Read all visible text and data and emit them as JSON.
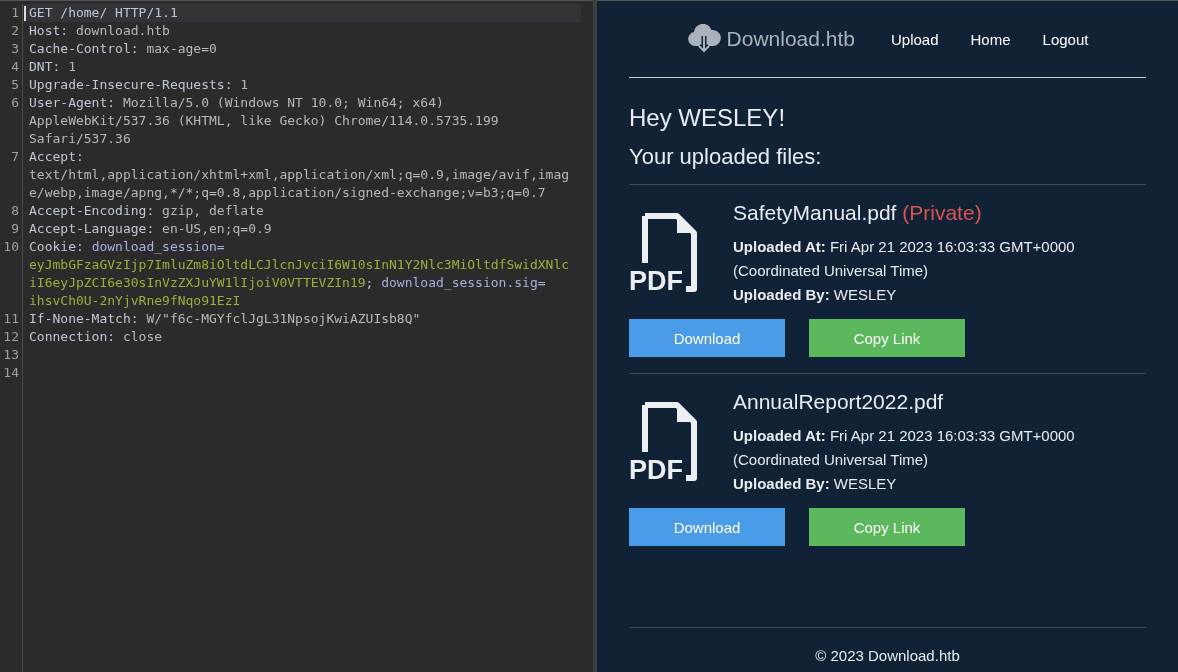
{
  "request_editor": {
    "rows": [
      {
        "number": "1",
        "current": true,
        "parts": [
          {
            "kind": "name",
            "text": "GET /home/ HTTP/1.1"
          }
        ]
      },
      {
        "number": "2",
        "current": false,
        "parts": [
          {
            "kind": "name",
            "text": "Host: "
          },
          {
            "kind": "value",
            "text": "download.htb"
          }
        ]
      },
      {
        "number": "3",
        "current": false,
        "parts": [
          {
            "kind": "name",
            "text": "Cache-Control: "
          },
          {
            "kind": "value",
            "text": "max-age=0"
          }
        ]
      },
      {
        "number": "4",
        "current": false,
        "parts": [
          {
            "kind": "name",
            "text": "DNT: "
          },
          {
            "kind": "value",
            "text": "1"
          }
        ]
      },
      {
        "number": "5",
        "current": false,
        "parts": [
          {
            "kind": "name",
            "text": "Upgrade-Insecure-Requests: "
          },
          {
            "kind": "value",
            "text": "1"
          }
        ]
      },
      {
        "number": "6",
        "current": false,
        "parts": [
          {
            "kind": "name",
            "text": "User-Agent: "
          },
          {
            "kind": "value",
            "text": "Mozilla/5.0 (Windows NT 10.0; Win64; x64)"
          }
        ]
      },
      {
        "current": false,
        "parts": [
          {
            "kind": "value",
            "text": "AppleWebKit/537.36 (KHTML, like Gecko) Chrome/114.0.5735.199"
          }
        ]
      },
      {
        "current": false,
        "parts": [
          {
            "kind": "value",
            "text": "Safari/537.36"
          }
        ]
      },
      {
        "number": "7",
        "current": false,
        "parts": [
          {
            "kind": "name",
            "text": "Accept:"
          }
        ]
      },
      {
        "current": false,
        "parts": [
          {
            "kind": "value",
            "text": "text/html,application/xhtml+xml,application/xml;q=0.9,image/avif,imag"
          }
        ]
      },
      {
        "current": false,
        "parts": [
          {
            "kind": "value",
            "text": "e/webp,image/apng,*/*;q=0.8,application/signed-exchange;v=b3;q=0.7"
          }
        ]
      },
      {
        "number": "8",
        "current": false,
        "parts": [
          {
            "kind": "name",
            "text": "Accept-Encoding: "
          },
          {
            "kind": "value",
            "text": "gzip, deflate"
          }
        ]
      },
      {
        "number": "9",
        "current": false,
        "parts": [
          {
            "kind": "name",
            "text": "Accept-Language: "
          },
          {
            "kind": "value",
            "text": "en-US,en;q=0.9"
          }
        ]
      },
      {
        "number": "10",
        "current": false,
        "parts": [
          {
            "kind": "name",
            "text": "Cookie: "
          },
          {
            "kind": "key",
            "text": "download_session="
          }
        ]
      },
      {
        "current": false,
        "parts": [
          {
            "kind": "cookie",
            "text": "eyJmbGFzaGVzIjp7ImluZm8iOltdLCJlcnJvciI6W10sInN1Y2Nlc3MiOltdfSwidXNlc"
          }
        ]
      },
      {
        "current": false,
        "parts": [
          {
            "kind": "cookie",
            "text": "iI6eyJpZCI6e30sInVzZXJuYW1lIjoiV0VTTEVZIn19"
          },
          {
            "kind": "name",
            "text": "; "
          },
          {
            "kind": "key",
            "text": "download_session.sig="
          }
        ]
      },
      {
        "current": false,
        "parts": [
          {
            "kind": "cookie",
            "text": "ihsvCh0U-2nYjvRne9fNqo91EzI"
          }
        ]
      },
      {
        "number": "11",
        "current": false,
        "parts": [
          {
            "kind": "name",
            "text": "If-None-Match: "
          },
          {
            "kind": "value",
            "text": "W/\"f6c-MGYfclJgL31NpsojKwiAZUIsb8Q\""
          }
        ]
      },
      {
        "number": "12",
        "current": false,
        "parts": [
          {
            "kind": "name",
            "text": "Connection: "
          },
          {
            "kind": "value",
            "text": "close"
          }
        ]
      },
      {
        "number": "13",
        "current": false
      },
      {
        "number": "14",
        "current": false
      }
    ]
  },
  "site": {
    "brand": "Download.htb",
    "nav": [
      "Upload",
      "Home",
      "Logout"
    ],
    "greeting": "Hey WESLEY!",
    "subheading": "Your uploaded files:",
    "files": [
      {
        "icon_label": "PDF",
        "name": "SafetyManual.pdf",
        "private_label": "(Private)",
        "uploaded_at": "**Uploaded At:** Fri Apr 21 2023 16:03:33 GMT+0000 (Coordinated Universal Time)",
        "uploaded_by": "**Uploaded By:** WESLEY",
        "buttons": [
          "Download",
          "Copy Link"
        ]
      },
      {
        "icon_label": "PDF",
        "name": "AnnualReport2022.pdf",
        "uploaded_at": "**Uploaded At:** Fri Apr 21 2023 16:03:33 GMT+0000 (Coordinated Universal Time)",
        "uploaded_by": "**Uploaded By:** WESLEY",
        "buttons": [
          "Download",
          "Copy Link"
        ]
      }
    ],
    "footer": "© 2023 Download.htb"
  }
}
